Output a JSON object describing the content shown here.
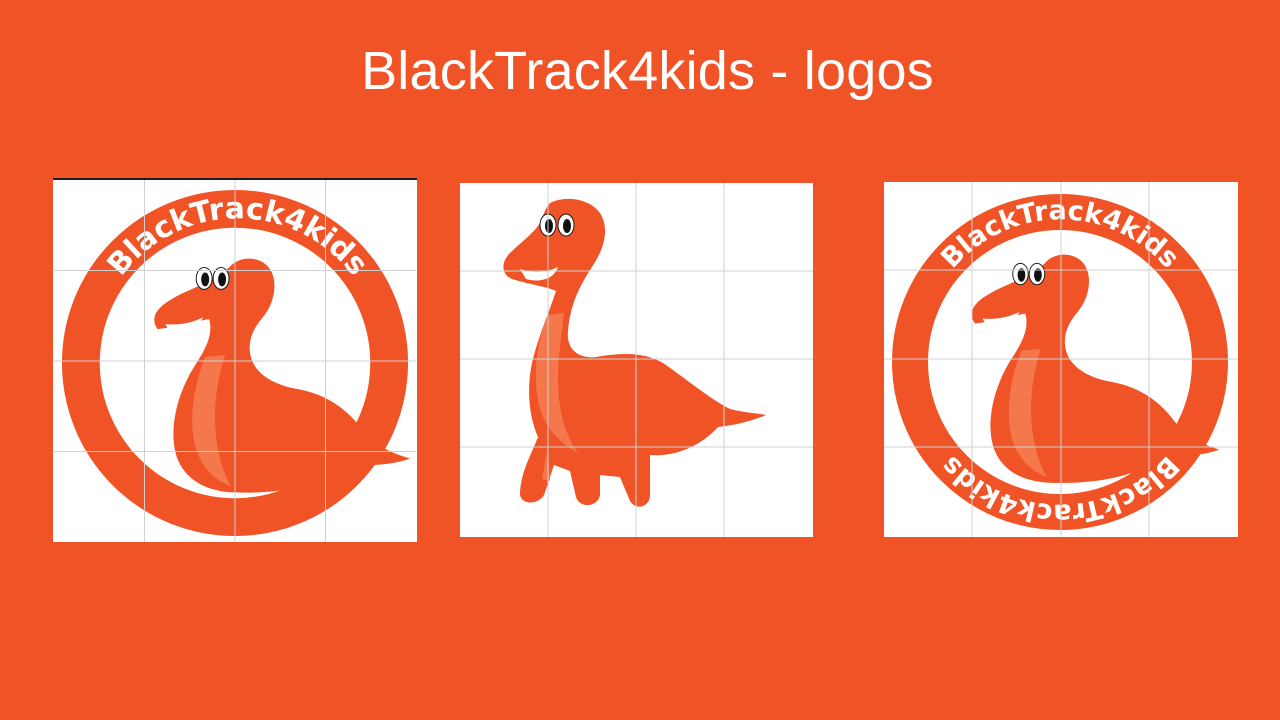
{
  "slide": {
    "title": "BlackTrack4kids - logos"
  },
  "logos": [
    {
      "variant": "circle-badge-top-text",
      "text_top": "BlackTrack4kids"
    },
    {
      "variant": "dinosaur-only"
    },
    {
      "variant": "circle-badge-top-bottom-text",
      "text_top": "BlackTrack4kids",
      "text_bottom": "BlackTrack4kids"
    }
  ],
  "colors": {
    "background": "#F05325",
    "brand_orange": "#F05325",
    "highlight": "#F5774C",
    "card": "#FFFFFF",
    "title_text": "#FFFFFF",
    "grid_lines": "#D0D0D0"
  },
  "icons": {
    "mascot": "dinosaur-icon"
  }
}
